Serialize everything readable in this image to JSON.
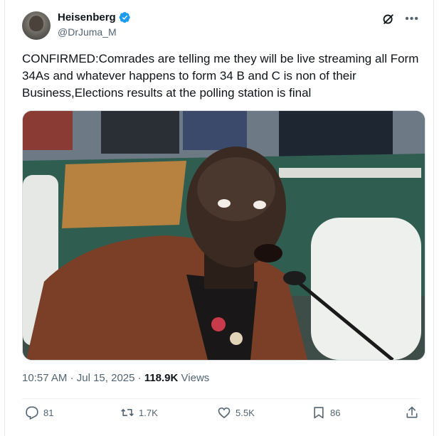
{
  "tweet": {
    "author": {
      "display_name": "Heisenberg",
      "handle": "@DrJuma_M",
      "verified": true
    },
    "text": "CONFIRMED:Comrades are telling me they will be live streaming all Form 34As and whatever happens to form 34 B and C is non of their Business,Elections results at the polling station is final",
    "time": "10:57 AM",
    "separator": "·",
    "date": "Jul 15, 2025",
    "views_count": "118.9K",
    "views_label": "Views",
    "replies": "81",
    "reposts": "1.7K",
    "likes": "5.5K",
    "bookmarks": "86"
  },
  "icons": {
    "verified": "verified-badge-icon",
    "grok": "grok-icon",
    "more": "more-options-icon",
    "reply": "reply-icon",
    "repost": "repost-icon",
    "like": "heart-icon",
    "bookmark": "bookmark-icon",
    "share": "share-icon"
  },
  "colors": {
    "verified_blue": "#1d9bf0",
    "muted": "#536471",
    "text": "#0f1419"
  }
}
